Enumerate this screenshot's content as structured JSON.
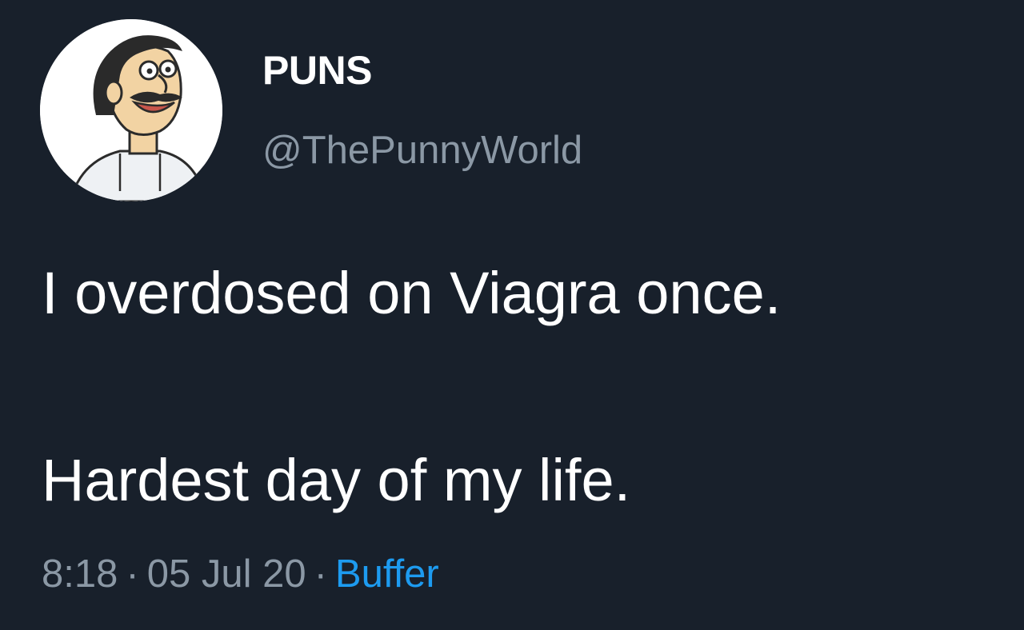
{
  "tweet": {
    "display_name": "PUNS",
    "handle": "@ThePunnyWorld",
    "text_line_1": "I overdosed on Viagra once.",
    "text_line_2": "Hardest day of my life.",
    "time": "8:18",
    "date": "05 Jul 20",
    "separator": "·",
    "source": "Buffer"
  },
  "avatar": {
    "icon": "cartoon-man-avatar"
  },
  "colors": {
    "background": "#18202b",
    "text": "#ffffff",
    "muted": "#8b98a5",
    "link": "#1d9bf0"
  }
}
